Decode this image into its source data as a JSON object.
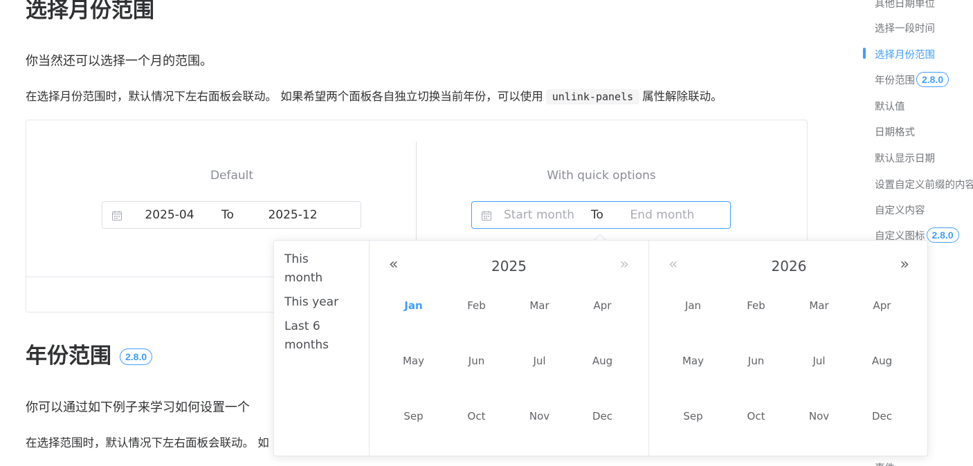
{
  "section1": {
    "title": "选择月份范围",
    "desc": "你当然还可以选择一个月的范围。",
    "note_before": "在选择月份范围时，默认情况下左右面板会联动。 如果希望两个面板各自独立切换当前年份，可以使用",
    "note_code": "unlink-panels",
    "note_after": "属性解除联动。"
  },
  "demo": {
    "default_label": "Default",
    "quick_label": "With quick options",
    "default_range": {
      "start": "2025-04",
      "separator": "To",
      "end": "2025-12"
    },
    "quick_range": {
      "start_placeholder": "Start month",
      "separator": "To",
      "end_placeholder": "End month"
    }
  },
  "popup": {
    "shortcuts": [
      "This month",
      "This year",
      "Last 6 months"
    ],
    "left_year": "2025",
    "right_year": "2026",
    "prev_icon": "double-chevron-left-icon",
    "next_icon": "double-chevron-right-icon",
    "months": [
      "Jan",
      "Feb",
      "Mar",
      "Apr",
      "May",
      "Jun",
      "Jul",
      "Aug",
      "Sep",
      "Oct",
      "Nov",
      "Dec"
    ],
    "current_month": "Jan",
    "accent_color": "#409eff"
  },
  "section2": {
    "title": "年份范围",
    "badge": "2.8.0",
    "desc": "你可以通过如下例子来学习如何设置一个",
    "note": "在选择范围时，默认情况下左右面板会联动。 如"
  },
  "toc": {
    "items": [
      {
        "label": "其他日期单位",
        "badge": ""
      },
      {
        "label": "选择一段时间",
        "badge": ""
      },
      {
        "label": "选择月份范围",
        "badge": ""
      },
      {
        "label": "年份范围",
        "badge": "2.8.0"
      },
      {
        "label": "默认值",
        "badge": ""
      },
      {
        "label": "日期格式",
        "badge": ""
      },
      {
        "label": "默认显示日期",
        "badge": ""
      },
      {
        "label": "设置自定义前缀的内容",
        "badge": ""
      },
      {
        "label": "自定义内容",
        "badge": ""
      },
      {
        "label": "自定义图标",
        "badge": "2.8.0"
      },
      {
        "label": "事件",
        "badge": ""
      }
    ],
    "active_index": 2
  }
}
